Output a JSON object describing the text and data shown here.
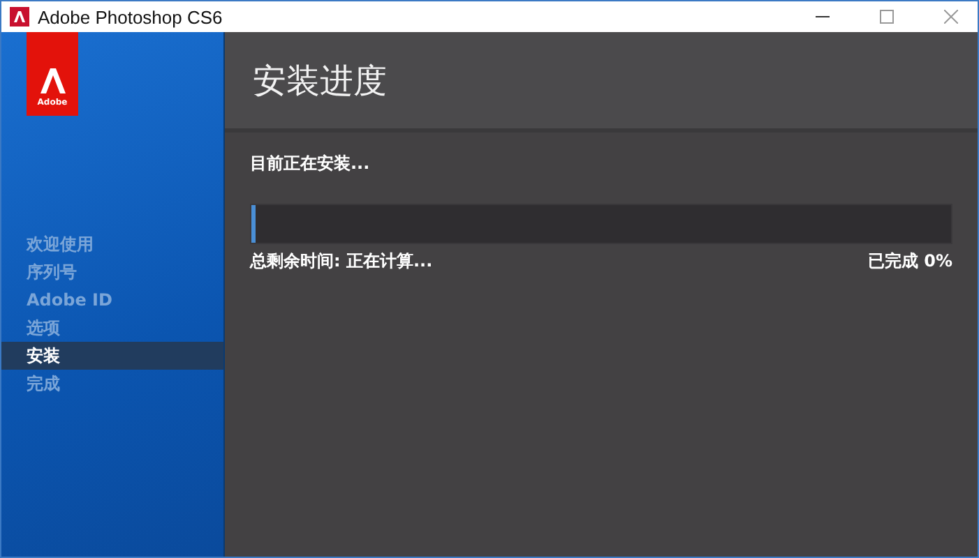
{
  "window": {
    "title": "Adobe Photoshop CS6"
  },
  "logo": {
    "label": "Adobe"
  },
  "sidebar": {
    "items": [
      {
        "label": "欢迎使用",
        "selected": false
      },
      {
        "label": "序列号",
        "selected": false
      },
      {
        "label": "Adobe ID",
        "selected": false
      },
      {
        "label": "选项",
        "selected": false
      },
      {
        "label": "安装",
        "selected": true
      },
      {
        "label": "完成",
        "selected": false
      }
    ]
  },
  "header": {
    "title": "安装进度"
  },
  "status": "目前正在安装...",
  "progress": {
    "level": 0.005,
    "remaining": "总剩余时间: 正在计算...",
    "done": "已完成 0%"
  }
}
